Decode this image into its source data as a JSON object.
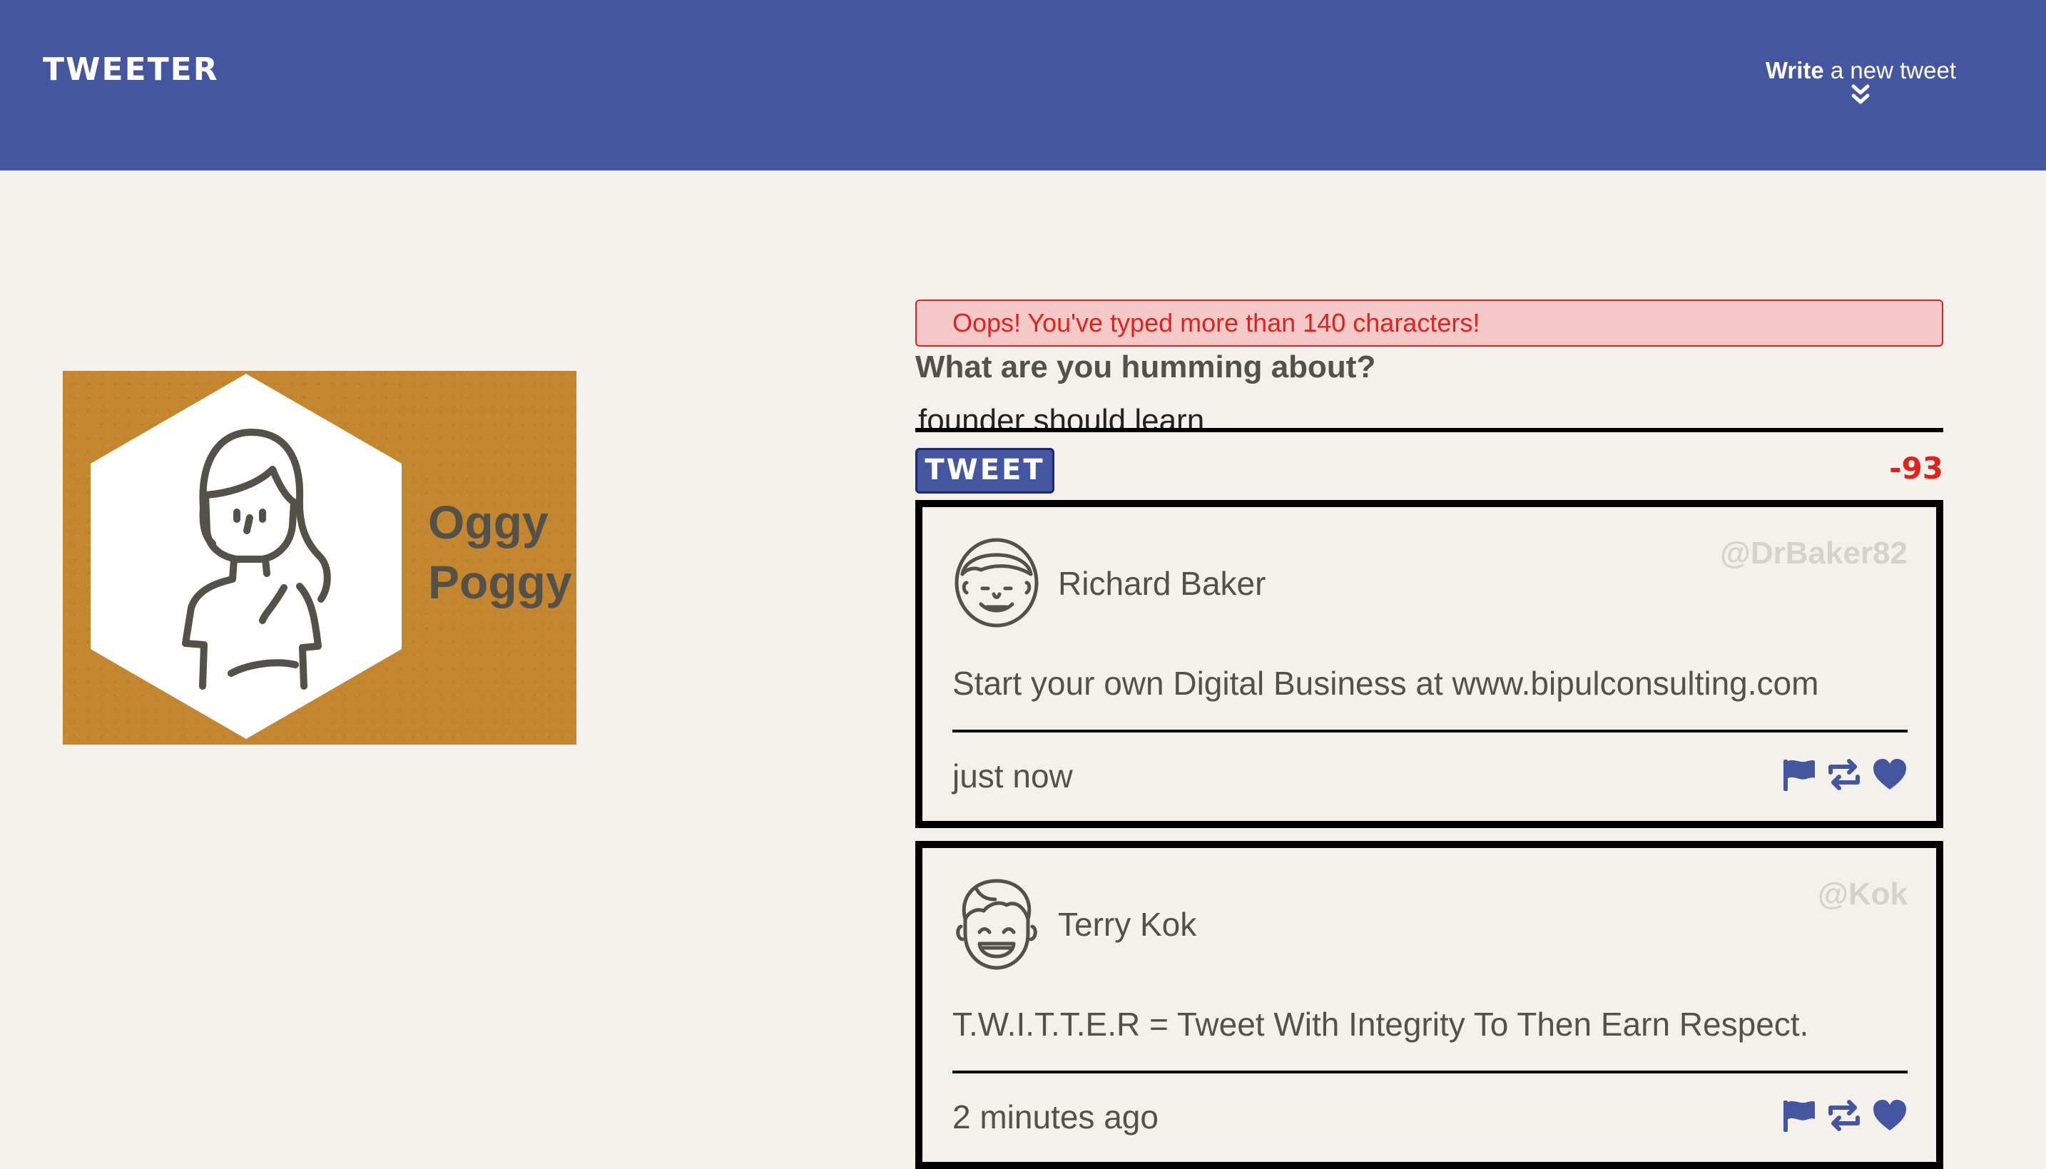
{
  "nav": {
    "brand": "TWEETER",
    "compose_toggle_bold": "Write",
    "compose_toggle_rest": " a new tweet"
  },
  "profile": {
    "first_name": "Oggy",
    "last_name": "Poggy"
  },
  "compose": {
    "error": "Oops! You've typed more than 140 characters!",
    "label": "What are you humming about?",
    "textarea_value": "founder should learn",
    "button_label": "TWEET",
    "counter": "-93"
  },
  "tweets": [
    {
      "author": "Richard Baker",
      "handle": "@DrBaker82",
      "text": "Start your own Digital Business at www.bipulconsulting.com",
      "time": "just now",
      "avatar": "smiling-man-avatar"
    },
    {
      "author": "Terry Kok",
      "handle": "@Kok",
      "text": "T.W.I.T.T.E.R = Tweet With Integrity To Then Earn Respect.",
      "time": "2 minutes ago",
      "avatar": "laughing-boy-avatar"
    }
  ],
  "icons": {
    "flag": "flag-icon",
    "retweet": "retweet-icon",
    "like": "heart-icon",
    "chevron": "double-chevron-down-icon"
  },
  "colors": {
    "nav": "#4556a0",
    "accent": "#4556a0",
    "error": "#e0221c",
    "error_bg": "#f6c9c9",
    "profile_bg": "#c4862f",
    "page_bg": "#f4f1ec",
    "text": "#545149"
  }
}
